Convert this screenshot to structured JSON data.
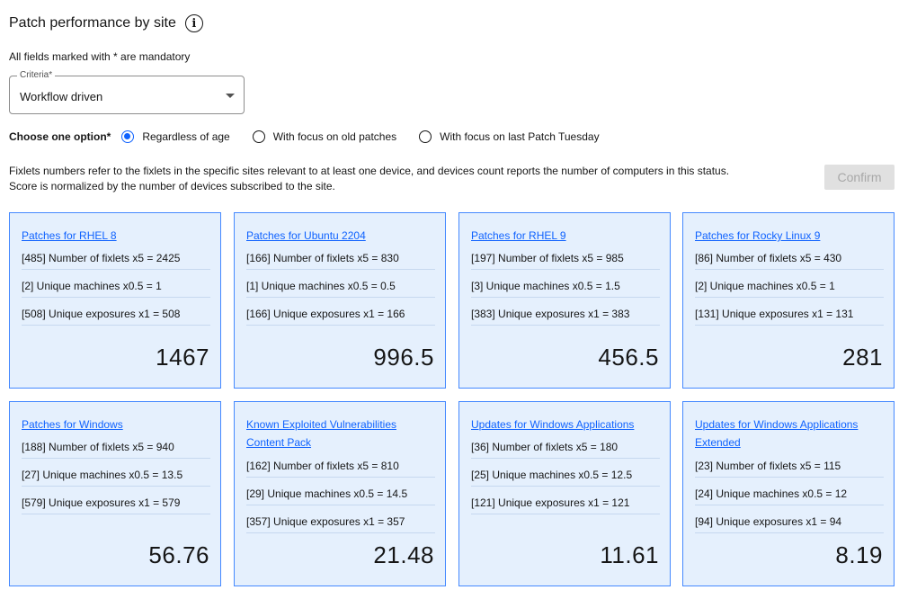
{
  "header": {
    "title": "Patch performance by site",
    "info_icon": "info-icon"
  },
  "form": {
    "mandatory_note": "All fields marked with * are mandatory",
    "criteria_label": "Criteria*",
    "criteria_value": "Workflow driven",
    "option_label": "Choose one option*",
    "options": [
      {
        "label": "Regardless of age",
        "selected": true
      },
      {
        "label": "With focus on old patches",
        "selected": false
      },
      {
        "label": "With focus on last Patch Tuesday",
        "selected": false
      }
    ],
    "description_line1": "Fixlets numbers refer to the fixlets in the specific sites relevant to at least one device, and devices count reports the number of computers in this status.",
    "description_line2": "Score is normalized by the number of devices subscribed to the site.",
    "confirm_label": "Confirm"
  },
  "cards": [
    {
      "title": "Patches for RHEL 8",
      "fixlets": "[485] Number of fixlets x5 = 2425",
      "machines": "[2] Unique machines x0.5 = 1",
      "exposures": "[508] Unique exposures x1 = 508",
      "score": "1467"
    },
    {
      "title": "Patches for Ubuntu 2204",
      "fixlets": "[166] Number of fixlets x5 = 830",
      "machines": "[1] Unique machines x0.5 = 0.5",
      "exposures": "[166] Unique exposures x1 = 166",
      "score": "996.5"
    },
    {
      "title": "Patches for RHEL 9",
      "fixlets": "[197] Number of fixlets x5 = 985",
      "machines": "[3] Unique machines x0.5 = 1.5",
      "exposures": "[383] Unique exposures x1 = 383",
      "score": "456.5"
    },
    {
      "title": "Patches for Rocky Linux 9",
      "fixlets": "[86] Number of fixlets x5 = 430",
      "machines": "[2] Unique machines x0.5 = 1",
      "exposures": "[131] Unique exposures x1 = 131",
      "score": "281"
    },
    {
      "title": "Patches for Windows",
      "fixlets": "[188] Number of fixlets x5 = 940",
      "machines": "[27] Unique machines x0.5 = 13.5",
      "exposures": "[579] Unique exposures x1 = 579",
      "score": "56.76"
    },
    {
      "title": "Known Exploited Vulnerabilities Content Pack",
      "fixlets": "[162] Number of fixlets x5 = 810",
      "machines": "[29] Unique machines x0.5 = 14.5",
      "exposures": "[357] Unique exposures x1 = 357",
      "score": "21.48"
    },
    {
      "title": "Updates for Windows Applications",
      "fixlets": "[36] Number of fixlets x5 = 180",
      "machines": "[25] Unique machines x0.5 = 12.5",
      "exposures": "[121] Unique exposures x1 = 121",
      "score": "11.61"
    },
    {
      "title": "Updates for Windows Applications Extended",
      "fixlets": "[23] Number of fixlets x5 = 115",
      "machines": "[24] Unique machines x0.5 = 12",
      "exposures": "[94] Unique exposures x1 = 94",
      "score": "8.19"
    }
  ]
}
